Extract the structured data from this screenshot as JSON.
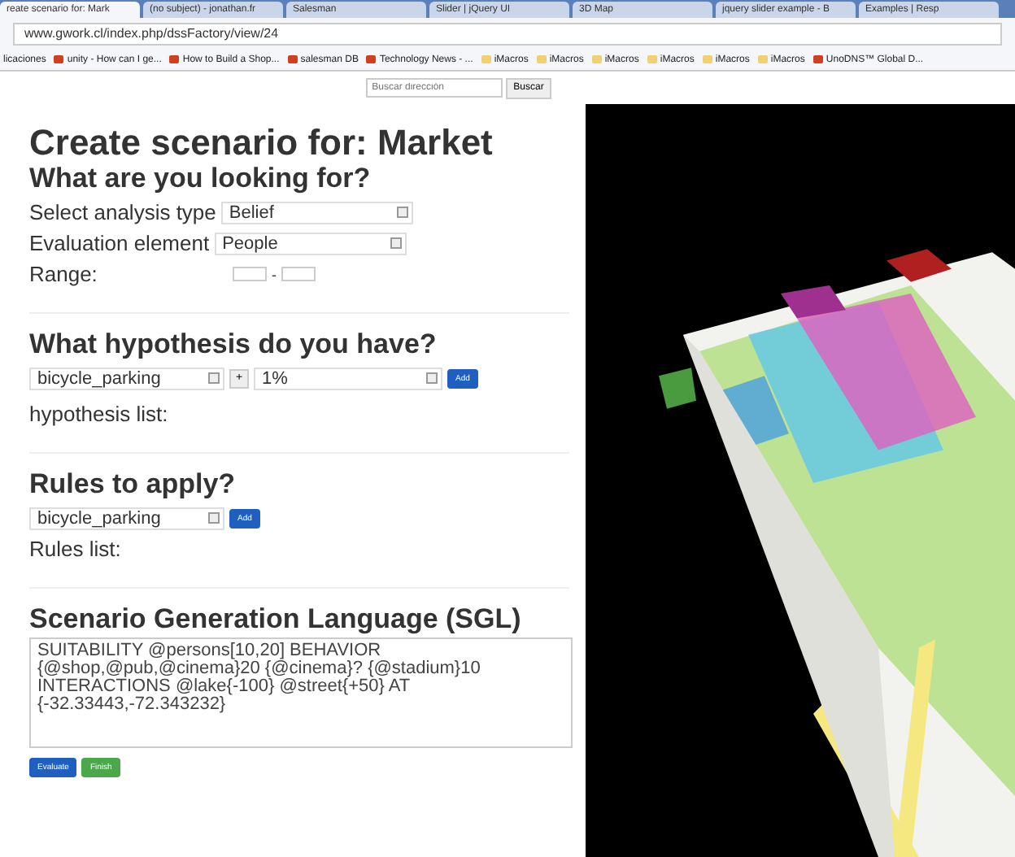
{
  "browser": {
    "tabs": [
      {
        "label": "reate scenario for: Mark",
        "selected": true
      },
      {
        "label": "(no subject) - jonathan.fr",
        "selected": false
      },
      {
        "label": "Salesman",
        "selected": false
      },
      {
        "label": "Slider | jQuery UI",
        "selected": false
      },
      {
        "label": "3D Map",
        "selected": false
      },
      {
        "label": "jquery slider example - B",
        "selected": false
      },
      {
        "label": "Examples | Resp",
        "selected": false
      }
    ],
    "address": "www.gwork.cl/index.php/dssFactory/view/24",
    "bookmarks": [
      {
        "label": "licaciones",
        "kind": "plain"
      },
      {
        "label": "unity - How can I ge...",
        "kind": "site"
      },
      {
        "label": "How to Build a Shop...",
        "kind": "site"
      },
      {
        "label": "salesman DB",
        "kind": "site"
      },
      {
        "label": "Technology News - ...",
        "kind": "site"
      },
      {
        "label": "iMacros",
        "kind": "folder"
      },
      {
        "label": "iMacros",
        "kind": "folder"
      },
      {
        "label": "iMacros",
        "kind": "folder"
      },
      {
        "label": "iMacros",
        "kind": "folder"
      },
      {
        "label": "iMacros",
        "kind": "folder"
      },
      {
        "label": "iMacros",
        "kind": "folder"
      },
      {
        "label": "UnoDNS™ Global D...",
        "kind": "site"
      }
    ]
  },
  "map_search": {
    "placeholder": "Buscar dirección",
    "button": "Buscar"
  },
  "form": {
    "title": "Create scenario for: Market",
    "looking": {
      "heading": "What are you looking for?",
      "analysis_label": "Select analysis type",
      "analysis_value": "Belief",
      "element_label": "Evaluation element",
      "element_value": "People",
      "range_label": "Range:",
      "range_separator": "-"
    },
    "hypothesis": {
      "heading": "What hypothesis do you have?",
      "item": "bicycle_parking",
      "operator": "+",
      "amount": "1%",
      "add": "Add",
      "list_label": "hypothesis list:"
    },
    "rules": {
      "heading": "Rules to apply?",
      "item": "bicycle_parking",
      "add": "Add",
      "list_label": "Rules list:"
    },
    "sgl": {
      "heading": "Scenario Generation Language (SGL)",
      "value": "SUITABILITY @persons[10,20] BEHAVIOR {@shop,@pub,@cinema}20 {@cinema}? {@stadium}10 INTERACTIONS @lake{-100} @street{+50} AT {-32.33443,-72.343232}"
    },
    "buttons": [
      {
        "label": "Evaluate",
        "kind": "primary"
      },
      {
        "label": "Finish",
        "kind": "success"
      }
    ]
  }
}
